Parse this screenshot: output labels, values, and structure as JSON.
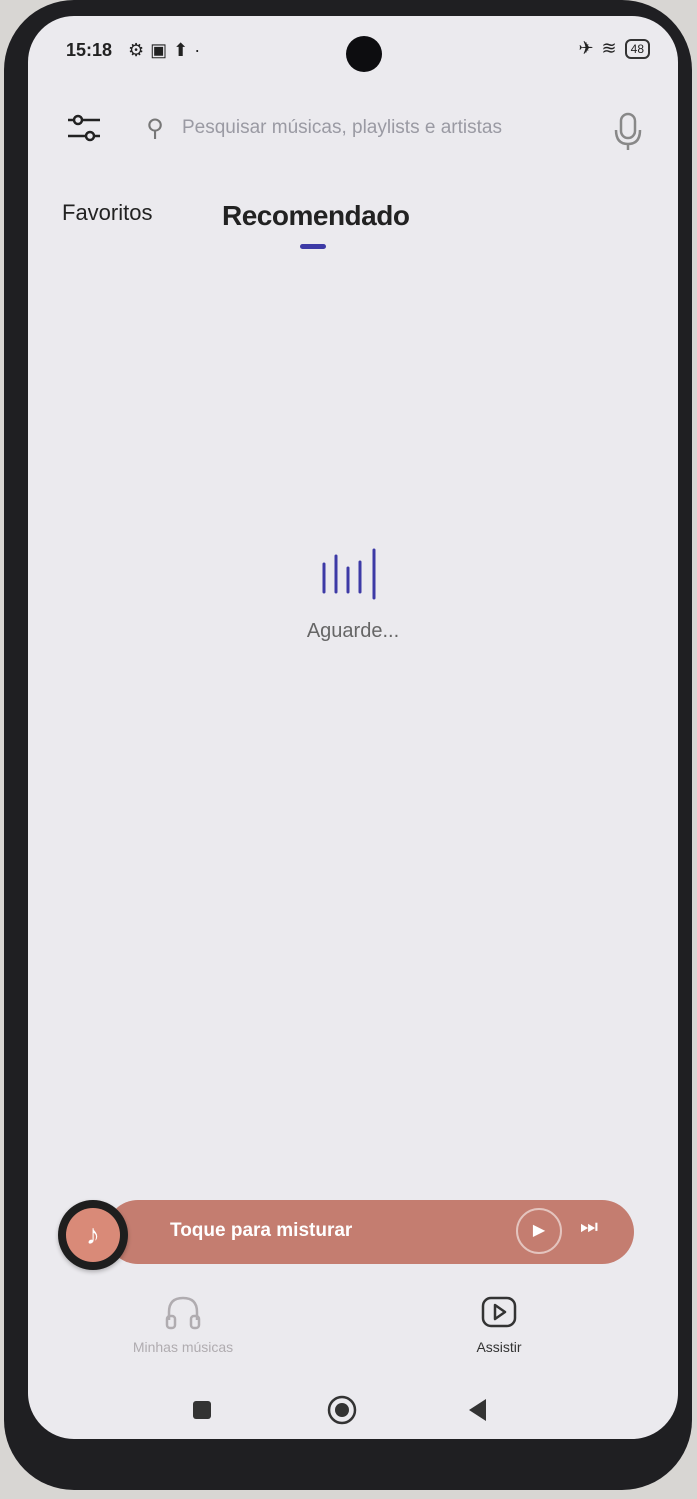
{
  "status_bar": {
    "time": "15:18",
    "icons": [
      "settings-icon",
      "gallery-icon",
      "upload-icon"
    ],
    "battery": "48"
  },
  "top_bar": {
    "search_placeholder": "Pesquisar músicas, playlists e artistas"
  },
  "tabs": [
    {
      "label": "Favoritos",
      "selected": false
    },
    {
      "label": "Recomendado",
      "selected": true
    }
  ],
  "loading": {
    "text": "Aguarde..."
  },
  "mini_player": {
    "label": "Toque para misturar"
  },
  "bottom_nav": [
    {
      "label": "Minhas músicas",
      "icon": "headphones-icon"
    },
    {
      "label": "Assistir",
      "icon": "play-square-icon"
    }
  ],
  "colors": {
    "accent": "#3d3aa6",
    "player": "#c47d70",
    "background": "#ebeaee"
  }
}
